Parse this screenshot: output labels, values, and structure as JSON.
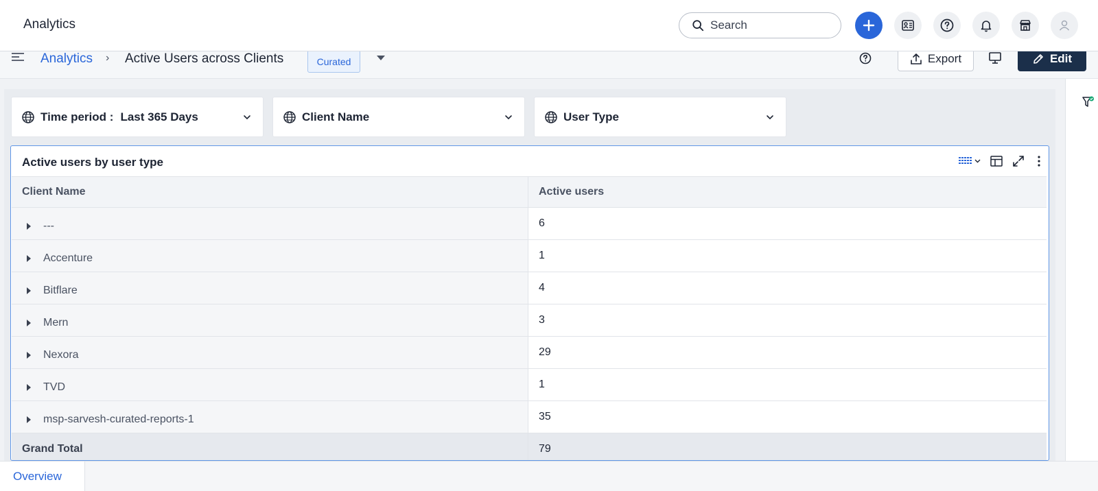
{
  "app": {
    "title": "Analytics"
  },
  "search": {
    "placeholder": "Search"
  },
  "topbar_icons": [
    "plus-icon",
    "contacts-list-icon",
    "help-icon",
    "bell-icon",
    "store-icon",
    "user-avatar-icon"
  ],
  "breadcrumb": {
    "root": "Analytics",
    "separator": "›",
    "current": "Active Users across Clients",
    "badge": "Curated"
  },
  "actions": {
    "export_label": "Export",
    "edit_label": "Edit"
  },
  "filters": [
    {
      "label": "Time period :",
      "value": "Last 365 Days"
    },
    {
      "label": "Client Name",
      "value": ""
    },
    {
      "label": "User Type",
      "value": ""
    }
  ],
  "widget": {
    "title": "Active users by user type",
    "columns": [
      "Client Name",
      "Active users"
    ],
    "rows": [
      {
        "name": "---",
        "value": "6"
      },
      {
        "name": "Accenture",
        "value": "1"
      },
      {
        "name": "Bitflare",
        "value": "4"
      },
      {
        "name": "Mern",
        "value": "3"
      },
      {
        "name": "Nexora",
        "value": "29"
      },
      {
        "name": "TVD",
        "value": "1"
      },
      {
        "name": "msp-sarvesh-curated-reports-1",
        "value": "35"
      }
    ],
    "total": {
      "label": "Grand Total",
      "value": "79"
    }
  },
  "tabs": [
    {
      "label": "Overview",
      "active": true
    }
  ],
  "colors": {
    "accent": "#2a66d9",
    "edit_button": "#1b2f4a",
    "widget_border": "#5e95e6"
  }
}
